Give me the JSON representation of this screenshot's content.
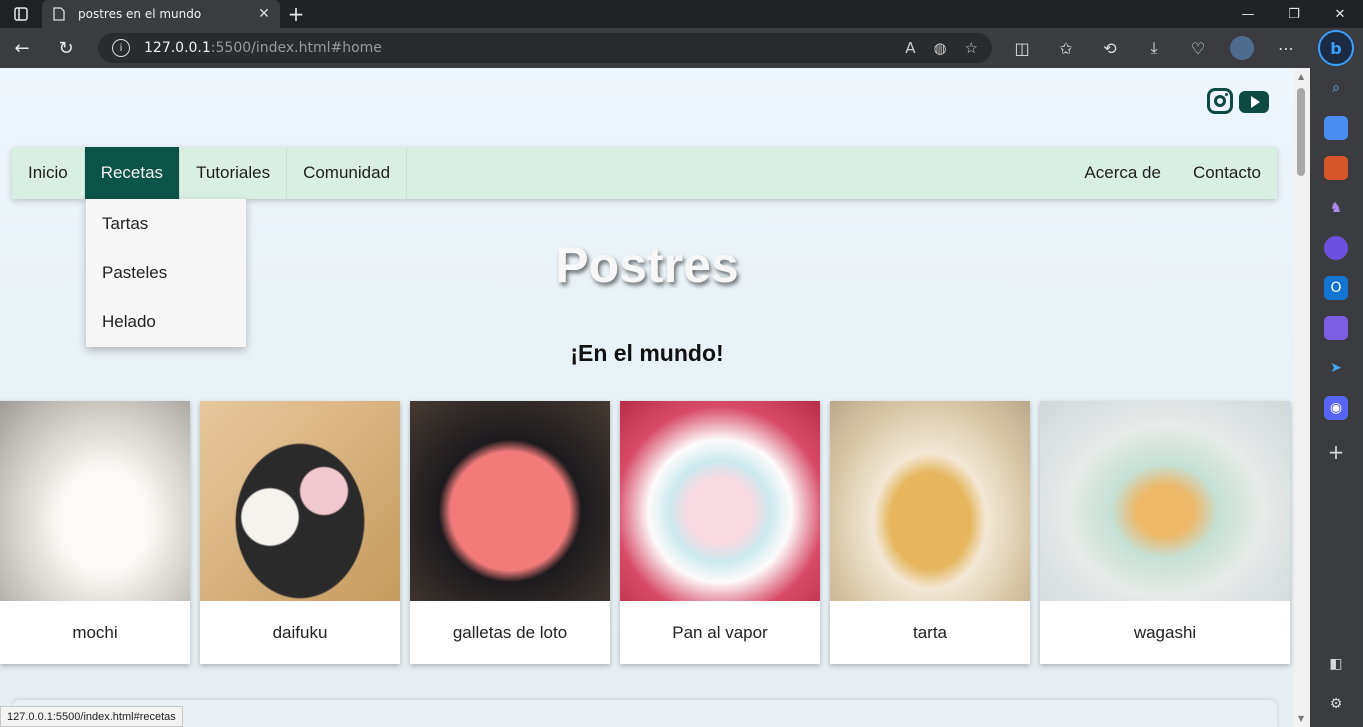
{
  "browser": {
    "tab_title": "postres en el mundo",
    "url_host": "127.0.0.1",
    "url_path": ":5500/index.html#home",
    "status_url": "127.0.0.1:5500/index.html#recetas"
  },
  "site": {
    "nav": {
      "left": [
        "Inicio",
        "Recetas",
        "Tutoriales",
        "Comunidad"
      ],
      "right": [
        "Acerca de",
        "Contacto"
      ],
      "active": "Recetas"
    },
    "dropdown": [
      "Tartas",
      "Pasteles",
      "Helado"
    ],
    "title": "Postres",
    "subtitle": "¡En el mundo!",
    "cards": [
      "mochi",
      "daifuku",
      "galletas de loto",
      "Pan al vapor",
      "tarta",
      "wagashi"
    ],
    "colors": {
      "nav_bg": "#d9efe4",
      "accent": "#0c5447",
      "social": "#0c4a42"
    }
  }
}
